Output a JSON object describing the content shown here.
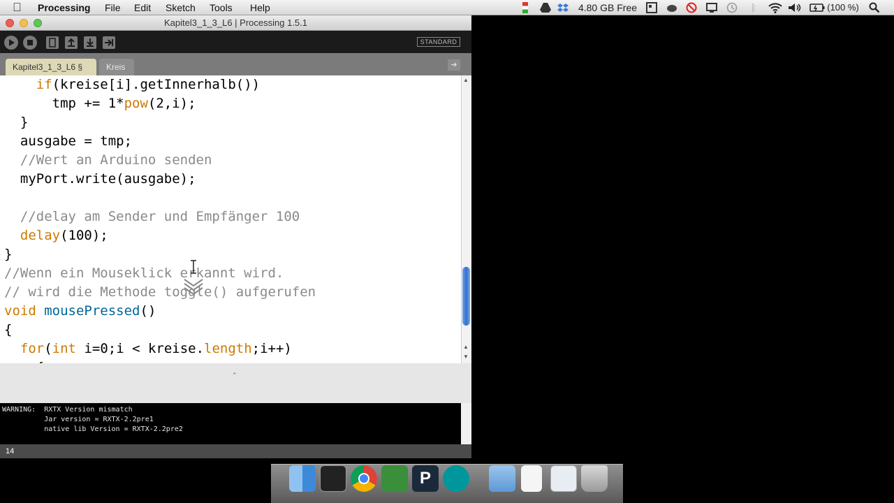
{
  "menubar": {
    "app": "Processing",
    "menus": [
      "File",
      "Edit",
      "Sketch",
      "Tools",
      "Help"
    ],
    "disk_free": "4.80 GB Free",
    "battery": "(100 %)"
  },
  "window": {
    "title": "Kapitel3_1_3_L6 | Processing 1.5.1",
    "mode": "STANDARD",
    "tabs": [
      "Kapitel3_1_3_L6 §",
      "Kreis"
    ],
    "tab_arrow": "➜"
  },
  "code": {
    "lines": [
      "    if(kreise[i].getInnerhalb())",
      "      tmp += 1*pow(2,i);",
      "  }",
      "  ausgabe = tmp;",
      "  //Wert an Arduino senden",
      "  myPort.write(ausgabe);",
      "",
      "  //delay am Sender und Empfänger 100",
      "  delay(100);",
      "}",
      "//Wenn ein Mouseklick erkannt wird.",
      "// wird die Methode toggle() aufgerufen",
      "void mousePressed()",
      "{",
      "  for(int i=0;i < kreise.length;i++)",
      "    {"
    ]
  },
  "console": {
    "lines": [
      "WARNING:  RXTX Version mismatch",
      "          Jar version = RXTX-2.2pre1",
      "          native lib Version = RXTX-2.2pre2"
    ]
  },
  "status": {
    "line_number": "14"
  },
  "colors": {
    "comment": "#8a8a8a",
    "keyword": "#cc7a00",
    "function": "#006699",
    "toolbar": "#1b1b1b",
    "tab_active": "#ddd9b7"
  },
  "dock": {
    "apps": [
      "finder-icon",
      "terminal-icon",
      "chrome-icon",
      "coda-icon",
      "processing-icon",
      "arduino-icon",
      "folder-icon",
      "document-icon",
      "preview-icon",
      "trash-icon"
    ]
  }
}
